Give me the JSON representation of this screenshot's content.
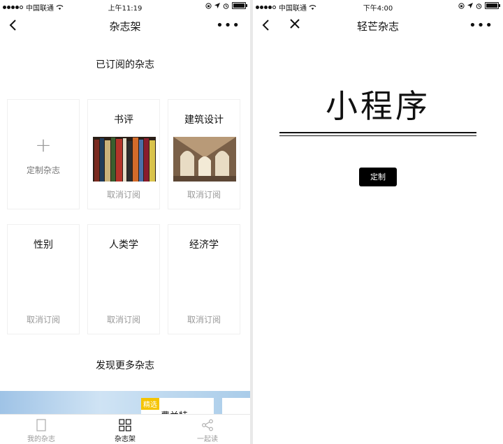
{
  "left": {
    "status": {
      "carrier": "中国联通",
      "time": "上午11:19"
    },
    "nav": {
      "title": "杂志架"
    },
    "subscribed_title": "已订阅的杂志",
    "custom_card_label": "定制杂志",
    "magazines": [
      {
        "name": "书评",
        "cancel": "取消订阅"
      },
      {
        "name": "建筑设计",
        "cancel": "取消订阅"
      },
      {
        "name": "性别",
        "cancel": "取消订阅"
      },
      {
        "name": "人类学",
        "cancel": "取消订阅"
      },
      {
        "name": "经济学",
        "cancel": "取消订阅"
      }
    ],
    "discover_title": "发现更多杂志",
    "banner": {
      "badge": "精选",
      "partial_title": "費兰特"
    },
    "tabs": [
      {
        "label": "我的杂志",
        "icon": "page-icon"
      },
      {
        "label": "杂志架",
        "icon": "grid-icon"
      },
      {
        "label": "一起读",
        "icon": "share-icon"
      }
    ]
  },
  "right": {
    "status": {
      "carrier": "中国联通",
      "time": "下午4:00"
    },
    "nav": {
      "title": "轻芒杂志"
    },
    "big_title": "小程序",
    "button_label": "定制"
  },
  "colors": {
    "accent_badge": "#f5c400",
    "muted_text": "#999999"
  }
}
